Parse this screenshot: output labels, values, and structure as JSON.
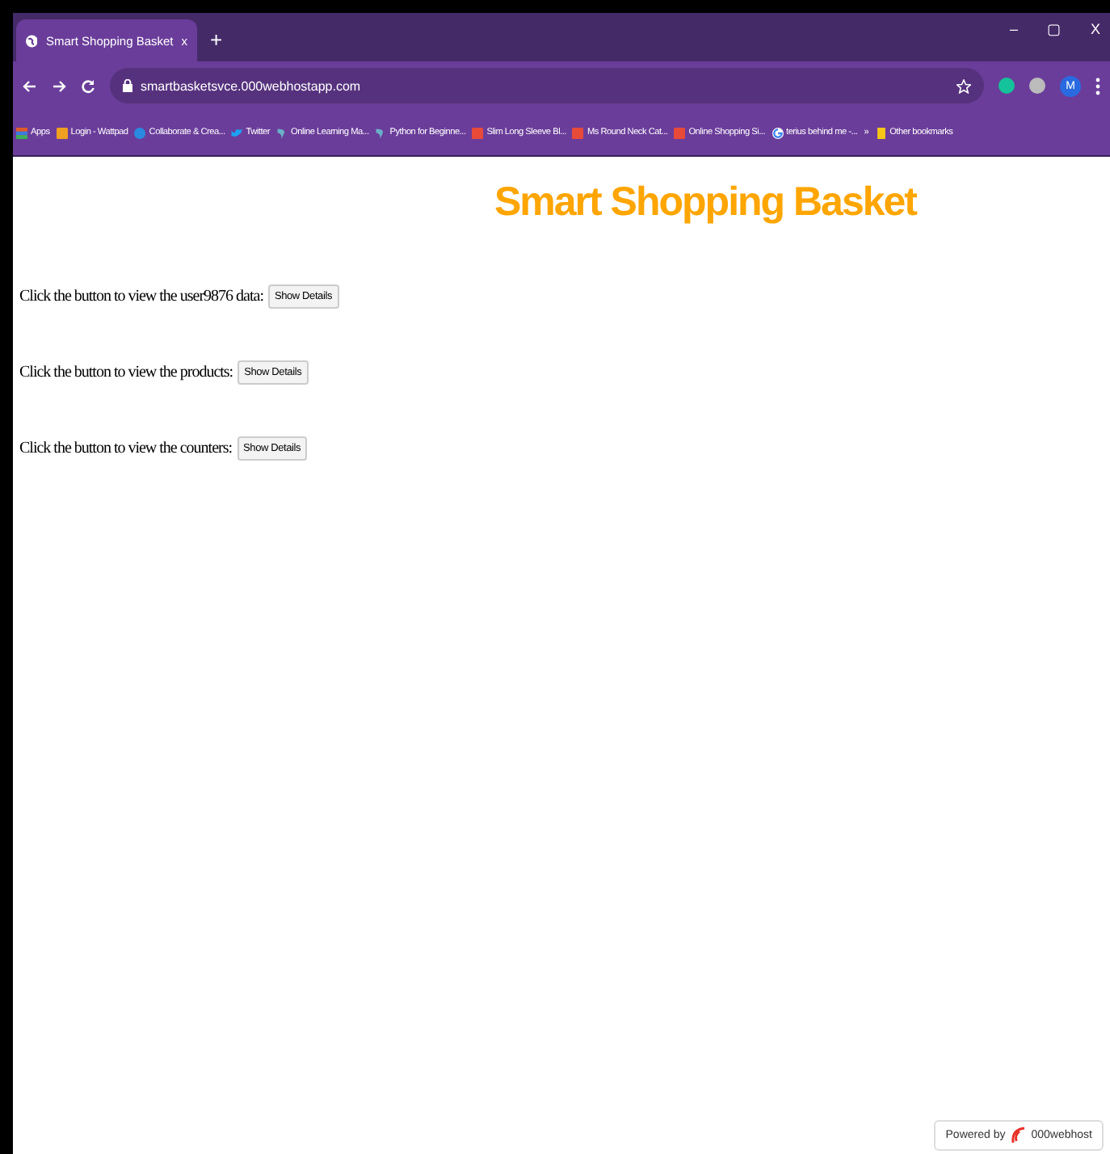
{
  "window": {
    "tab_title": "Smart Shopping Basket",
    "tab_close": "x",
    "new_tab": "+",
    "controls": [
      "–",
      "▢",
      "X"
    ]
  },
  "address_bar": {
    "url": "smartbasketsvce.000webhostapp.com",
    "profile_initial": "M"
  },
  "bookmarks": [
    {
      "label": "Apps",
      "kind": "apps"
    },
    {
      "label": "Login - Wattpad",
      "kind": "orange"
    },
    {
      "label": "Collaborate & Crea...",
      "kind": "blue"
    },
    {
      "label": "Twitter",
      "kind": "bird"
    },
    {
      "label": "Online Learning Ma...",
      "kind": "leaf"
    },
    {
      "label": "Python for Beginne...",
      "kind": "leaf"
    },
    {
      "label": "Slim Long Sleeve Bl...",
      "kind": "red"
    },
    {
      "label": "Ms Round Neck Cat...",
      "kind": "red"
    },
    {
      "label": "Online Shopping Si...",
      "kind": "red"
    },
    {
      "label": "terius behind me -...",
      "kind": "google"
    }
  ],
  "bookmarks_more": "»",
  "other_bookmarks": "Other bookmarks",
  "page": {
    "heading": "Smart Shopping Basket",
    "rows": [
      {
        "text": "Click the button to view the user9876 data:",
        "button": "Show Details"
      },
      {
        "text": "Click the button to view the products:",
        "button": "Show Details"
      },
      {
        "text": "Click the button to view the counters:",
        "button": "Show Details"
      }
    ]
  },
  "badge": {
    "prefix": "Powered by",
    "brand": "000webhost"
  }
}
